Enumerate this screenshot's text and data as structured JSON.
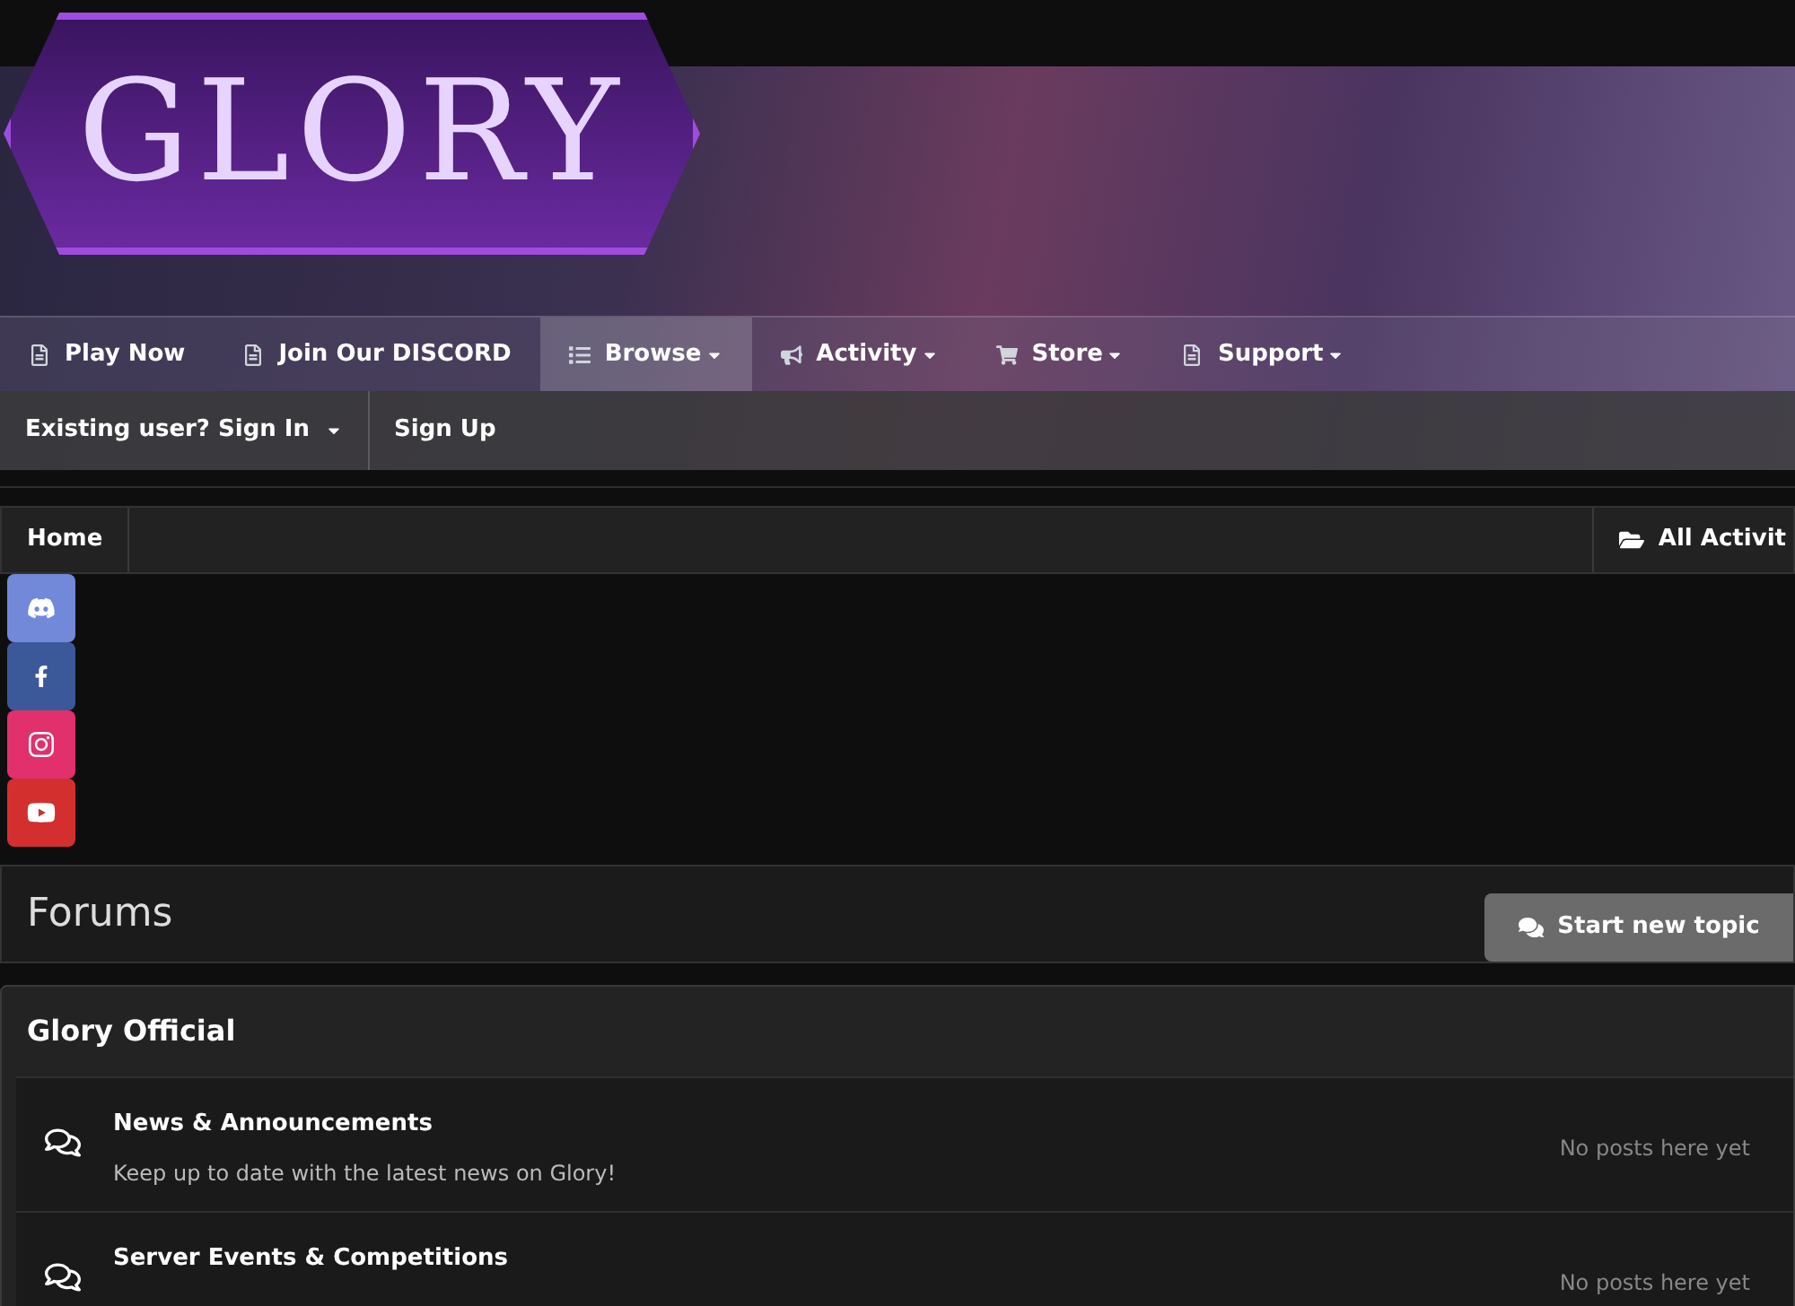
{
  "header": {
    "logo": "GLORY"
  },
  "nav": [
    {
      "label": "Play Now",
      "kind": "page",
      "dropdown": false,
      "selected": false
    },
    {
      "label": "Join Our DISCORD",
      "kind": "page",
      "dropdown": false,
      "selected": false
    },
    {
      "label": "Browse",
      "kind": "list",
      "dropdown": true,
      "selected": true
    },
    {
      "label": "Activity",
      "kind": "megaphone",
      "dropdown": true,
      "selected": false
    },
    {
      "label": "Store",
      "kind": "cart",
      "dropdown": true,
      "selected": false
    },
    {
      "label": "Support",
      "kind": "page",
      "dropdown": true,
      "selected": false
    }
  ],
  "userbar": [
    {
      "label": "Existing user? Sign In",
      "dropdown": true
    },
    {
      "label": "Sign Up",
      "dropdown": false
    }
  ],
  "breadcrumb": {
    "items": [
      "Home"
    ],
    "activity_link": "All Activit"
  },
  "social": [
    {
      "kind": "discord",
      "color": "#7289da"
    },
    {
      "kind": "facebook",
      "color": "#3b5998"
    },
    {
      "kind": "instagram",
      "color": "#e1306c"
    },
    {
      "kind": "youtube",
      "color": "#d32f2f"
    }
  ],
  "page": {
    "title": "Forums",
    "button": "Start new topic"
  },
  "category": {
    "title": "Glory Official",
    "forums": [
      {
        "name": "News & Announcements",
        "description": "Keep up to date with the latest news on Glory!",
        "last_post": "No posts here yet"
      },
      {
        "name": "Server Events & Competitions",
        "last_post": "No posts here yet"
      }
    ]
  }
}
